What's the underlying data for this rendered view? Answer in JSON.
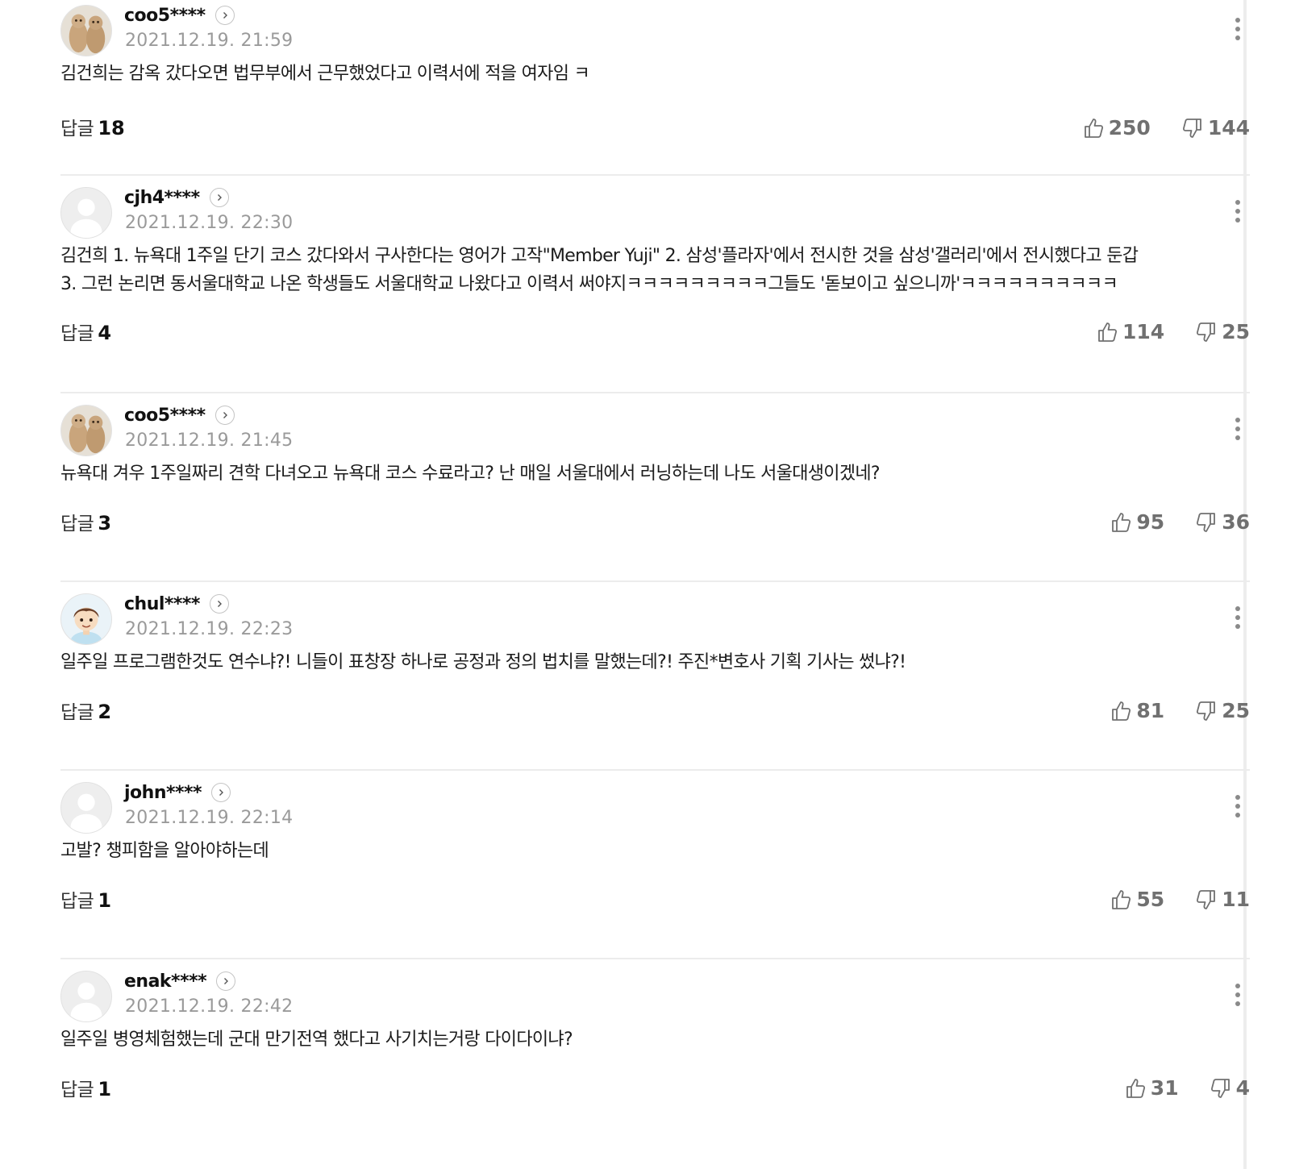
{
  "reply_label": "답글",
  "comments": [
    {
      "nickname": "coo5****",
      "avatar": "bear-photo-avatar",
      "timestamp": "2021.12.19. 21:59",
      "text_lines": [
        "김건희는 감옥 갔다오면 법무부에서 근무했었다고 이력서에 적을 여자임 ㅋ"
      ],
      "replies": "18",
      "likes": "250",
      "dislikes": "144"
    },
    {
      "nickname": "cjh4****",
      "avatar": "default-avatar",
      "timestamp": "2021.12.19. 22:30",
      "text_lines": [
        "김건희 1. 뉴욕대 1주일 단기 코스 갔다와서 구사한다는 영어가 고작\"Member Yuji\" 2. 삼성'플라자'에서 전시한 것을 삼성'갤러리'에서 전시했다고 둔갑",
        "3. 그런 논리면 동서울대학교 나온 학생들도 서울대학교 나왔다고 이력서 써야지ㅋㅋㅋㅋㅋㅋㅋㅋㅋ그들도 '돋보이고 싶으니까'ㅋㅋㅋㅋㅋㅋㅋㅋㅋㅋ"
      ],
      "replies": "4",
      "likes": "114",
      "dislikes": "25"
    },
    {
      "nickname": "coo5****",
      "avatar": "bear-photo-avatar",
      "timestamp": "2021.12.19. 21:45",
      "text_lines": [
        "뉴욕대 겨우 1주일짜리 견학 다녀오고 뉴욕대 코스 수료라고? 난 매일 서울대에서 러닝하는데 나도 서울대생이겠네?"
      ],
      "replies": "3",
      "likes": "95",
      "dislikes": "36"
    },
    {
      "nickname": "chul****",
      "avatar": "cartoon-boy-avatar",
      "timestamp": "2021.12.19. 22:23",
      "text_lines": [
        "일주일 프로그램한것도 연수냐?! 니들이 표창장 하나로 공정과 정의 법치를 말했는데?! 주진*변호사 기획 기사는 썼냐?!"
      ],
      "replies": "2",
      "likes": "81",
      "dislikes": "25"
    },
    {
      "nickname": "john****",
      "avatar": "default-avatar",
      "timestamp": "2021.12.19. 22:14",
      "text_lines": [
        "고발? 챙피함을 알아야하는데"
      ],
      "replies": "1",
      "likes": "55",
      "dislikes": "11"
    },
    {
      "nickname": "enak****",
      "avatar": "default-avatar",
      "timestamp": "2021.12.19. 22:42",
      "text_lines": [
        "일주일 병영체험했는데 군대 만기전역 했다고 사기치는거랑 다이다이냐?"
      ],
      "replies": "1",
      "likes": "31",
      "dislikes": "4"
    }
  ]
}
